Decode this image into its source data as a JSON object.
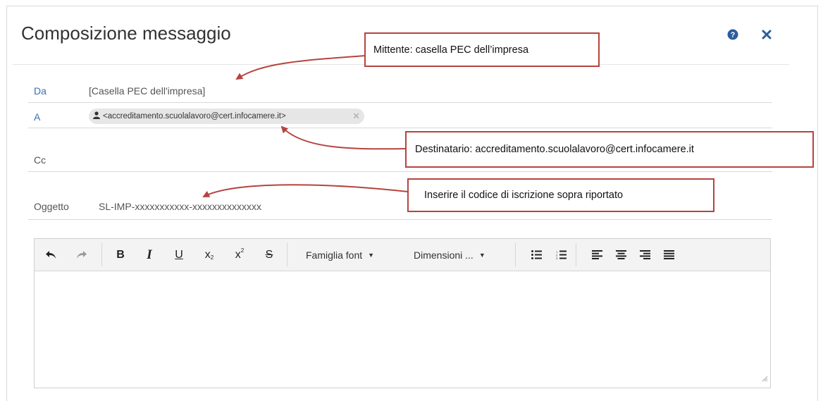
{
  "dialog": {
    "title": "Composizione messaggio",
    "help_icon": "question-circle-icon",
    "close_icon": "close-icon"
  },
  "fields": {
    "from_label": "Da",
    "from_value": "[Casella PEC dell'impresa]",
    "to_label": "A",
    "to_recipient": "<accreditamento.scuolalavoro@cert.infocamere.it>",
    "cc_label": "Cc",
    "subject_label": "Oggetto",
    "subject_value": "SL-IMP-xxxxxxxxxxx-xxxxxxxxxxxxxx"
  },
  "toolbar": {
    "font_family": "Famiglia font",
    "font_size": "Dimensioni ...",
    "buttons": [
      "undo-icon",
      "redo-icon",
      "bold-icon",
      "italic-icon",
      "underline-icon",
      "subscript-icon",
      "superscript-icon",
      "strikethrough-icon",
      "bullet-list-icon",
      "numbered-list-icon",
      "align-left-icon",
      "align-center-icon",
      "align-right-icon",
      "align-justify-icon"
    ]
  },
  "annotations": {
    "sender": "Mittente:  casella PEC dell’impresa",
    "recipient": "Destinatario:  accreditamento.scuolalavoro@cert.infocamere.it",
    "subject": "Inserire il codice di iscrizione sopra riportato"
  },
  "colors": {
    "label_blue": "#3a6fb0",
    "icon_blue": "#2a5d9f",
    "callout_border": "#b5443f"
  }
}
